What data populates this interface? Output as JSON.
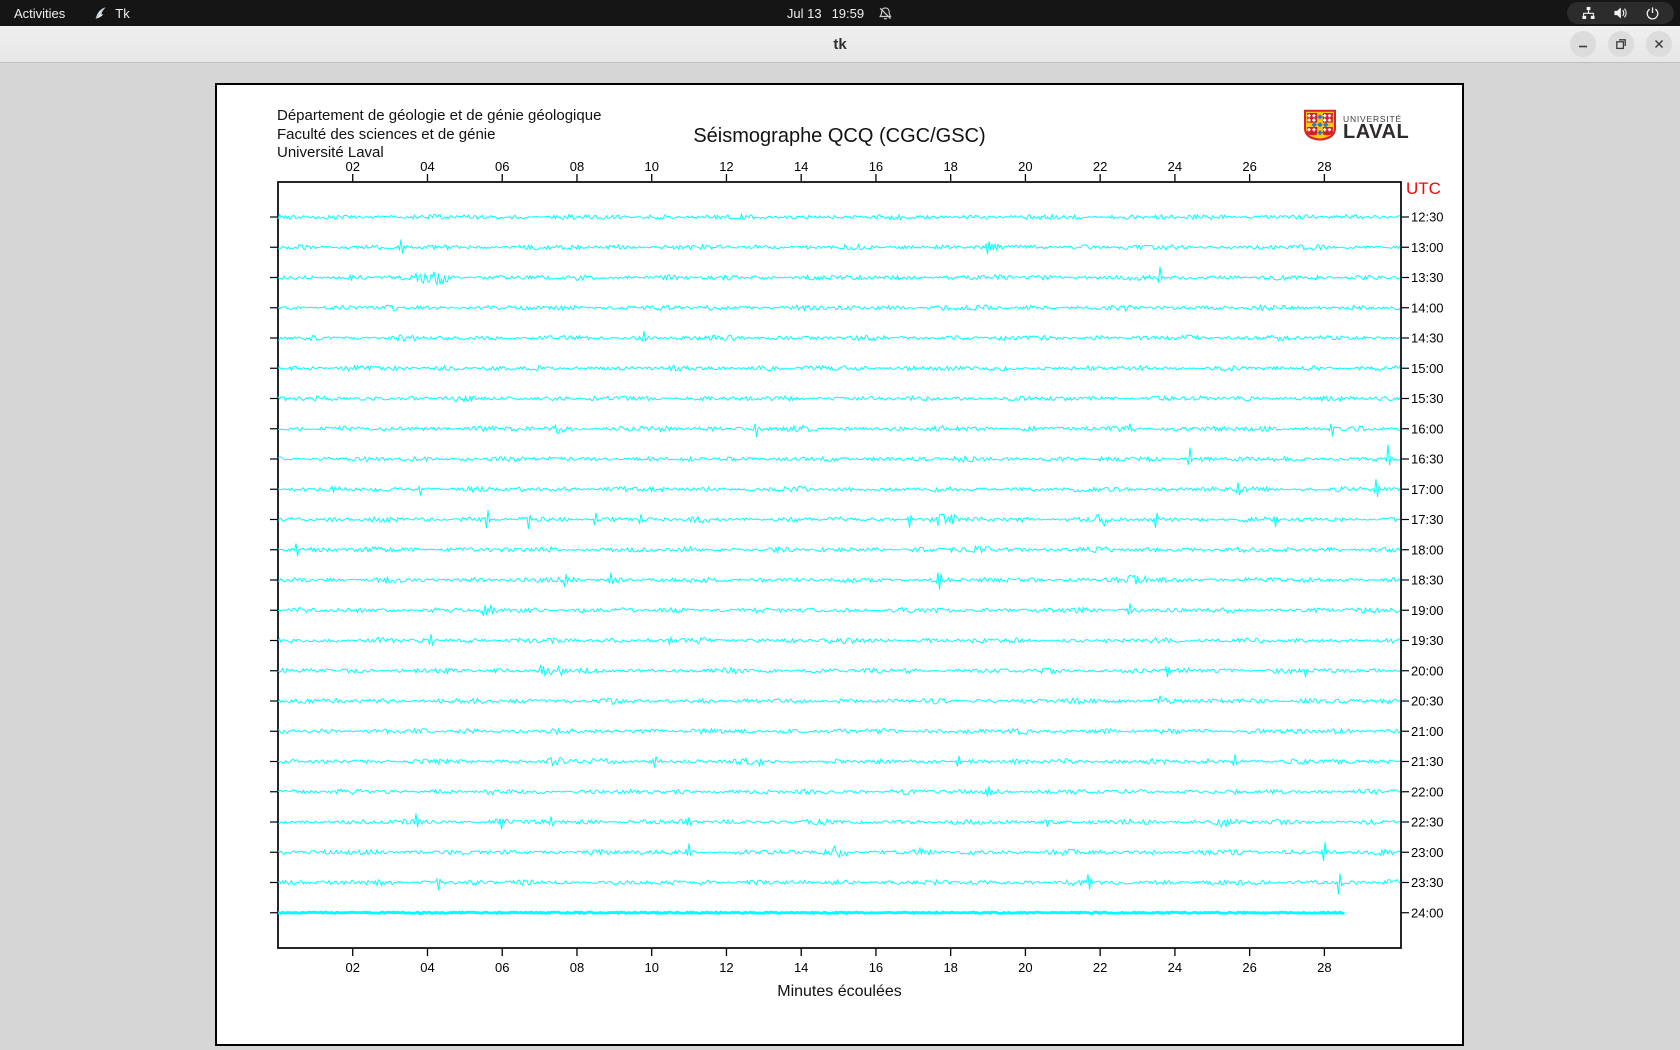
{
  "topbar": {
    "activities": "Activities",
    "app": "Tk",
    "date": "Jul 13",
    "time": "19:59",
    "icons": [
      "tk-feather-icon",
      "notifications-muted-icon",
      "network-icon",
      "volume-icon",
      "power-icon"
    ]
  },
  "titlebar": {
    "title": "tk",
    "buttons": [
      "minimize",
      "maximize",
      "close"
    ]
  },
  "window": {
    "header_line1": "Département de géologie et de génie géologique",
    "header_line2": "Faculté des sciences et de génie",
    "header_line3": "Université Laval",
    "logo_top": "UNIVERSITÉ",
    "logo_bottom": "LAVAL"
  },
  "chart_data": {
    "type": "line",
    "title": "Séismographe QCQ (CGC/GSC)",
    "xlabel": "Minutes écoulées",
    "right_axis_title": "UTC",
    "x_range": [
      0,
      30.05
    ],
    "x_tick_minutes": [
      2,
      4,
      6,
      8,
      10,
      12,
      14,
      16,
      18,
      20,
      22,
      24,
      26,
      28
    ],
    "x_tick_labels": [
      "02",
      "04",
      "06",
      "08",
      "10",
      "12",
      "14",
      "16",
      "18",
      "20",
      "22",
      "24",
      "26",
      "28"
    ],
    "grid": false,
    "legend": null,
    "trace_color": "#00ffff",
    "axis_color": "#000000",
    "utc_label_color": "#f40505",
    "rows": [
      {
        "label": "12:30",
        "spikes": [
          [
            14.2,
            4
          ]
        ],
        "bursts": []
      },
      {
        "label": "13:00",
        "spikes": [
          [
            3.3,
            9
          ],
          [
            19.0,
            8
          ]
        ],
        "bursts": []
      },
      {
        "label": "13:30",
        "spikes": [
          [
            23.6,
            10
          ]
        ],
        "bursts": [
          [
            4.1,
            0.9
          ]
        ]
      },
      {
        "label": "14:00",
        "spikes": [],
        "bursts": []
      },
      {
        "label": "14:30",
        "spikes": [
          [
            9.8,
            8
          ]
        ],
        "bursts": []
      },
      {
        "label": "15:00",
        "spikes": [],
        "bursts": []
      },
      {
        "label": "15:30",
        "spikes": [],
        "bursts": []
      },
      {
        "label": "16:00",
        "spikes": [
          [
            12.8,
            8
          ],
          [
            28.2,
            10
          ]
        ],
        "bursts": [
          [
            7.4,
            0.6
          ],
          [
            22.8,
            0.4
          ]
        ]
      },
      {
        "label": "16:30",
        "spikes": [
          [
            24.4,
            12
          ],
          [
            29.7,
            14
          ]
        ],
        "bursts": []
      },
      {
        "label": "17:00",
        "spikes": [
          [
            3.8,
            8
          ],
          [
            25.7,
            9
          ],
          [
            29.4,
            13
          ]
        ],
        "bursts": []
      },
      {
        "label": "17:30",
        "spikes": [
          [
            5.6,
            10
          ],
          [
            6.7,
            9
          ],
          [
            8.5,
            9
          ],
          [
            9.7,
            7
          ],
          [
            16.9,
            8
          ],
          [
            23.5,
            9
          ],
          [
            26.7,
            8
          ]
        ],
        "bursts": [
          [
            17.9,
            0.5
          ],
          [
            22.1,
            0.4
          ]
        ]
      },
      {
        "label": "18:00",
        "spikes": [
          [
            0.5,
            9
          ]
        ],
        "bursts": [
          [
            18.8,
            0.5
          ]
        ]
      },
      {
        "label": "18:30",
        "spikes": [
          [
            7.7,
            8
          ],
          [
            8.9,
            9
          ],
          [
            17.7,
            14
          ]
        ],
        "bursts": [
          [
            23.0,
            0.5
          ]
        ]
      },
      {
        "label": "19:00",
        "spikes": [
          [
            22.8,
            8
          ]
        ],
        "bursts": [
          [
            5.7,
            0.5
          ]
        ]
      },
      {
        "label": "19:30",
        "spikes": [
          [
            4.1,
            9
          ],
          [
            10.5,
            6
          ]
        ],
        "bursts": []
      },
      {
        "label": "20:00",
        "spikes": [
          [
            23.8,
            8
          ],
          [
            27.5,
            8
          ]
        ],
        "bursts": [
          [
            7.3,
            0.6
          ]
        ]
      },
      {
        "label": "20:30",
        "spikes": [
          [
            23.6,
            7
          ]
        ],
        "bursts": []
      },
      {
        "label": "21:00",
        "spikes": [],
        "bursts": []
      },
      {
        "label": "21:30",
        "spikes": [
          [
            10.1,
            8
          ],
          [
            12.9,
            9
          ],
          [
            18.2,
            8
          ],
          [
            25.6,
            8
          ]
        ],
        "bursts": [
          [
            7.4,
            0.5
          ]
        ]
      },
      {
        "label": "22:00",
        "spikes": [
          [
            19.0,
            8
          ]
        ],
        "bursts": []
      },
      {
        "label": "22:30",
        "spikes": [
          [
            3.7,
            7
          ],
          [
            6.0,
            8
          ],
          [
            7.3,
            7
          ],
          [
            11.0,
            8
          ],
          [
            20.6,
            8
          ]
        ],
        "bursts": [
          [
            25.3,
            0.6
          ]
        ]
      },
      {
        "label": "23:00",
        "spikes": [
          [
            11.0,
            8
          ],
          [
            17.2,
            7
          ],
          [
            28.0,
            12
          ]
        ],
        "bursts": [
          [
            15.0,
            0.5
          ]
        ]
      },
      {
        "label": "23:30",
        "spikes": [
          [
            4.3,
            9
          ],
          [
            21.7,
            11
          ],
          [
            28.4,
            16
          ]
        ],
        "bursts": []
      },
      {
        "label": "24:00",
        "spikes": [],
        "bursts": [],
        "flat": true,
        "end": 28.55
      }
    ]
  }
}
